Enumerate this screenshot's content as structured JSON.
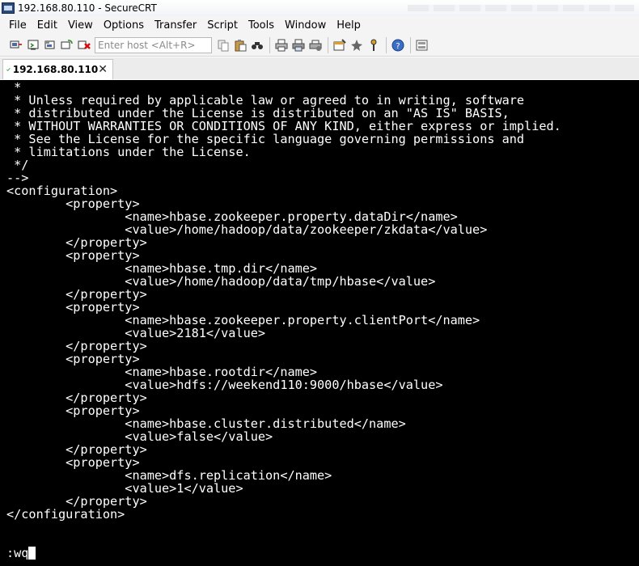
{
  "window": {
    "title": "192.168.80.110 - SecureCRT"
  },
  "menu": {
    "items": [
      "File",
      "Edit",
      "View",
      "Options",
      "Transfer",
      "Script",
      "Tools",
      "Window",
      "Help"
    ]
  },
  "toolbar": {
    "host_placeholder": "Enter host <Alt+R>",
    "icons": [
      "connect-icon",
      "quick-connect-icon",
      "connect-in-tab-icon",
      "reconnect-icon",
      "disconnect-icon",
      "copy-icon",
      "paste-icon",
      "find-icon",
      "print-icon",
      "print-selection-icon",
      "print-setup-icon",
      "session-options-icon",
      "map-keys-icon",
      "keymap-icon",
      "help-icon",
      "sftp-icon"
    ]
  },
  "tab": {
    "label": "192.168.80.110",
    "status_icon": "check-icon",
    "close_icon": "close-icon"
  },
  "terminal": {
    "lines": [
      " *",
      " * Unless required by applicable law or agreed to in writing, software",
      " * distributed under the License is distributed on an \"AS IS\" BASIS,",
      " * WITHOUT WARRANTIES OR CONDITIONS OF ANY KIND, either express or implied.",
      " * See the License for the specific language governing permissions and",
      " * limitations under the License.",
      " */",
      "-->",
      "<configuration>",
      "        <property>",
      "                <name>hbase.zookeeper.property.dataDir</name>",
      "                <value>/home/hadoop/data/zookeeper/zkdata</value>",
      "        </property>",
      "        <property>",
      "                <name>hbase.tmp.dir</name>",
      "                <value>/home/hadoop/data/tmp/hbase</value>",
      "        </property>",
      "        <property>",
      "                <name>hbase.zookeeper.property.clientPort</name>",
      "                <value>2181</value>",
      "        </property>",
      "        <property>",
      "                <name>hbase.rootdir</name>",
      "                <value>hdfs://weekend110:9000/hbase</value>",
      "        </property>",
      "        <property>",
      "                <name>hbase.cluster.distributed</name>",
      "                <value>false</value>",
      "        </property>",
      "        <property>",
      "                <name>dfs.replication</name>",
      "                <value>1</value>",
      "        </property>",
      "</configuration>"
    ],
    "command": ":wq",
    "colors": {
      "background": "#000000",
      "foreground": "#ffffff"
    }
  }
}
